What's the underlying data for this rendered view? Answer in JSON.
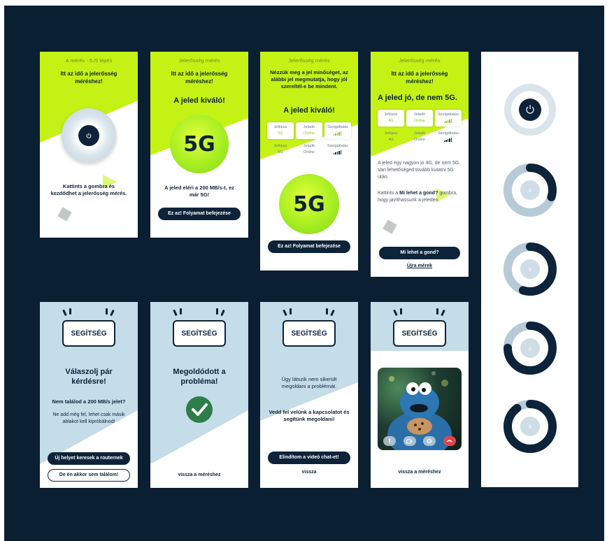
{
  "colors": {
    "background": "#0b1f33",
    "lime": "#c4f215",
    "navy": "#0d2339",
    "light_blue": "#c5dce9"
  },
  "screens": {
    "s1": {
      "top": "A mérés - 5./5 lépés",
      "title": "Itt az idő a jelerősség méréshez!",
      "instruction": "Kattints a gombra és kezdődhet a jelerősség mérés.",
      "icon": "power-icon"
    },
    "s2": {
      "top": "Jelerősség mérés",
      "title": "Itt az idő a jelerősség méréshez!",
      "result": "A jeled kiváló!",
      "badge": "5G",
      "description": "A jeled eléri a 200 MB/s-t, ez már 5G!",
      "button": "Ez az! Folyamat befejezése"
    },
    "s3": {
      "top": "Jelerősség mérés",
      "intro": "Nézzük meg a jel minőséget, az alábbi jel megmutatja, hogy jól szereltél-e be mindent.",
      "result": "A jeled kiváló!",
      "rows": [
        [
          {
            "label": "Jeltípus",
            "value": "5G"
          },
          {
            "label": "Jeladó",
            "value": "Online"
          },
          {
            "label": "Szolgáltatás",
            "value": ""
          }
        ],
        [
          {
            "label": "Jeltípus",
            "value": "5G"
          },
          {
            "label": "Jeladó",
            "value": "Online"
          },
          {
            "label": "Szolgáltatás",
            "value": ""
          }
        ]
      ],
      "badge": "5G",
      "button": "Ez az! Folyamat befejezése"
    },
    "s4": {
      "top": "Jelerősség mérés",
      "title": "Itt az idő a jelerősség méréshez!",
      "result": "A jeled jó, de nem 5G.",
      "rows": [
        [
          {
            "label": "Jeltípus",
            "value": "4G"
          },
          {
            "label": "Jeladó",
            "value": "Online"
          },
          {
            "label": "Szolgáltatás",
            "value": ""
          }
        ],
        [
          {
            "label": "Jeltípus",
            "value": "4G"
          },
          {
            "label": "Jeladó",
            "value": "Online"
          },
          {
            "label": "Szolgáltatás",
            "value": ""
          }
        ]
      ],
      "paragraph": "A jeled egy nagyon jó 4G, de nem 5G. Van lehetőséged tovább kutatni 5G után.",
      "hint_prefix": "Kattints a ",
      "hint_link": "Mi lehet a gond?",
      "hint_suffix": " gombra, hogy javíthassunk a jeleden.",
      "button": "Mi lehet a gond?",
      "link": "Újra mérek"
    },
    "s6": {
      "bubble": "SEGÍTSÉG",
      "title": "Válaszolj pár kérdésre!",
      "question": "Nem találod a 200 MB/s jelet?",
      "text": "Ne add még fel, lehet csak másik ablakot kell kipróbálnod!",
      "button": "Új helyet keresek a routernek",
      "button2": "De én akkor sem találom!"
    },
    "s7": {
      "bubble": "SEGÍTSÉG",
      "title": "Megoldódott a probléma!",
      "link": "vissza a méréshez"
    },
    "s8": {
      "bubble": "SEGÍTSÉG",
      "text": "Úgy látszik nem sikerült megoldani a problémát.",
      "text2": "Vedd fel velünk a kapcsolatot és segítünk megoldani!",
      "button": "Elindítom a videó chat-et!",
      "link": "vissza"
    },
    "s9": {
      "bubble": "SEGÍTSÉG",
      "link": "vissza a méréshez",
      "controls": [
        "mic-icon",
        "camera-icon",
        "settings-icon",
        "hangup-icon"
      ]
    },
    "progress": {
      "levels": [
        0,
        0.3,
        0.55,
        0.75,
        0.9
      ]
    }
  }
}
